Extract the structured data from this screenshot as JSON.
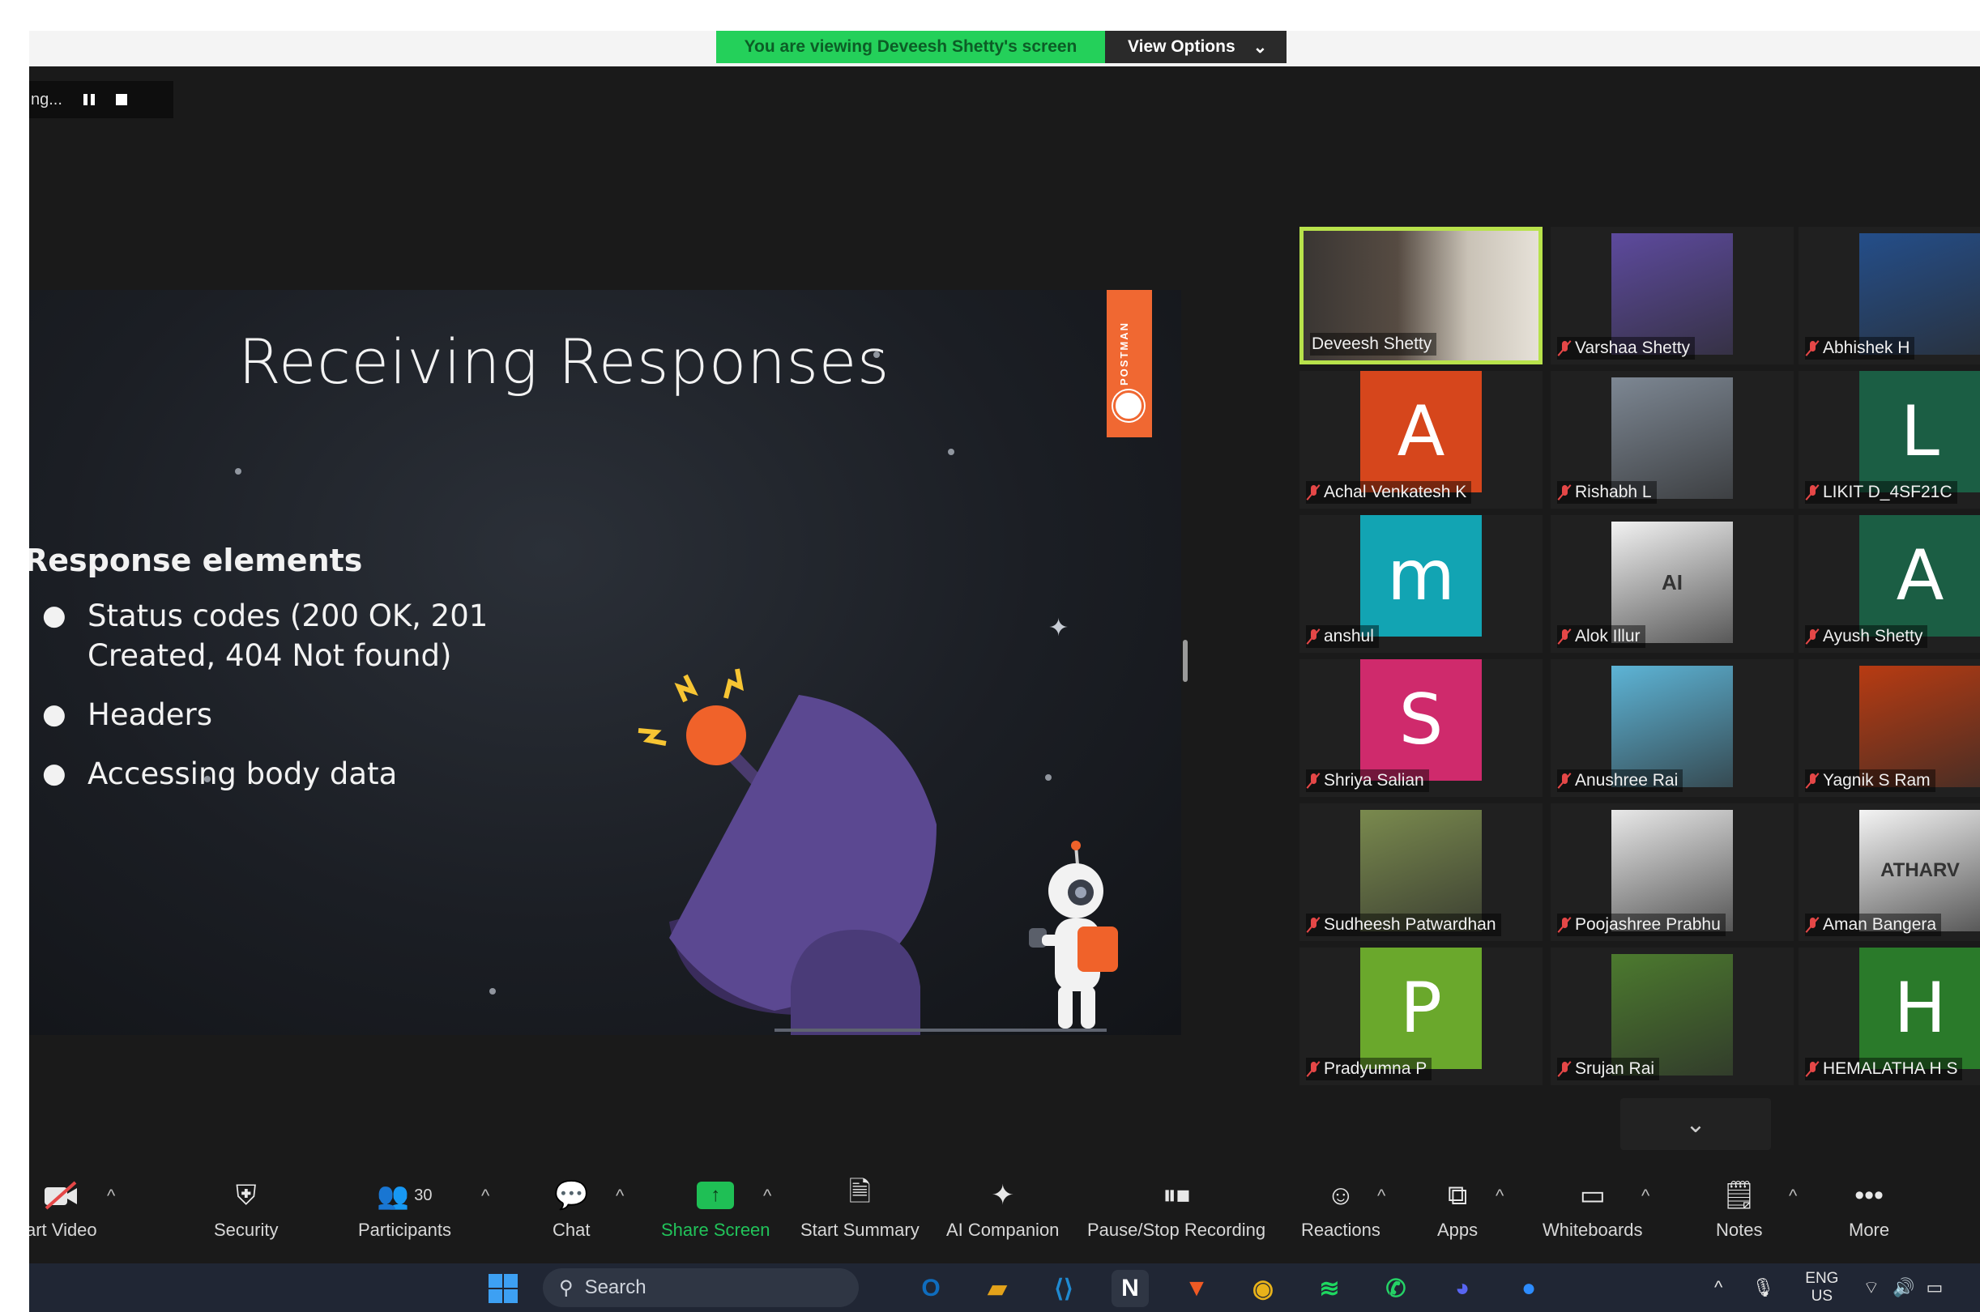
{
  "banner": {
    "viewing_text": "You are viewing Deveesh Shetty's screen",
    "view_options_label": "View Options"
  },
  "recording": {
    "status_text": "ng..."
  },
  "slide": {
    "title": "Receiving Responses",
    "brand_text": "POSTMAN",
    "heading": "Response elements",
    "bullets": [
      "Status codes (200 OK, 201\nCreated,  404 Not found)",
      "Headers",
      "Accessing body data"
    ]
  },
  "gallery": {
    "participants": [
      {
        "name": "Deveesh Shetty",
        "kind": "photo",
        "color": "#6b5a4e",
        "active": true
      },
      {
        "name": "Varshaa Shetty",
        "kind": "photo",
        "color": "#5d4a9e"
      },
      {
        "name": "Abhishek H",
        "kind": "photo",
        "color": "#244e8a"
      },
      {
        "name": "Achal Venkatesh K",
        "kind": "letter",
        "letter": "A",
        "color": "#d6461c"
      },
      {
        "name": "Rishabh L",
        "kind": "photo",
        "color": "#7d8793"
      },
      {
        "name": "LIKIT D_4SF21C",
        "kind": "letter",
        "letter": "L",
        "color": "#1b5e44"
      },
      {
        "name": "anshul",
        "kind": "letter",
        "letter": "m",
        "color": "#12a4b3"
      },
      {
        "name": "Alok Illur",
        "kind": "photo",
        "color": "#f2f2f2",
        "icon_text": "AI"
      },
      {
        "name": "Ayush Shetty",
        "kind": "letter",
        "letter": "A",
        "color": "#1b5e44"
      },
      {
        "name": "Shriya Salian",
        "kind": "letter",
        "letter": "S",
        "color": "#cf2a6c"
      },
      {
        "name": "Anushree Rai",
        "kind": "photo",
        "color": "#5db4d6"
      },
      {
        "name": "Yagnik S Ram",
        "kind": "photo",
        "color": "#b83b12"
      },
      {
        "name": "Sudheesh Patwardhan",
        "kind": "photo",
        "color": "#7a8a4e"
      },
      {
        "name": "Poojashree Prabhu",
        "kind": "photo",
        "color": "#e8e8e8"
      },
      {
        "name": "Aman Bangera",
        "kind": "photo",
        "color": "#f4f4f4",
        "icon_text": "ATHARV"
      },
      {
        "name": "Pradyumna P",
        "kind": "letter",
        "letter": "P",
        "color": "#6aa82c"
      },
      {
        "name": "Srujan Rai",
        "kind": "photo",
        "color": "#4c7a2e"
      },
      {
        "name": "HEMALATHA H S",
        "kind": "letter",
        "letter": "H",
        "color": "#2a7a2a"
      }
    ]
  },
  "toolbar": {
    "start_video": "art Video",
    "security": "Security",
    "participants": "Participants",
    "participants_count": "30",
    "chat": "Chat",
    "share_screen": "Share Screen",
    "start_summary": "Start Summary",
    "ai_companion": "AI Companion",
    "recording": "Pause/Stop Recording",
    "reactions": "Reactions",
    "apps": "Apps",
    "whiteboards": "Whiteboards",
    "notes": "Notes",
    "more": "More"
  },
  "taskbar": {
    "search_placeholder": "Search",
    "lang_top": "ENG",
    "lang_bottom": "US",
    "apps": [
      {
        "name": "outlook",
        "glyph": "O",
        "color": "#0f6cbd"
      },
      {
        "name": "file-explorer",
        "glyph": "▰",
        "color": "#e3a21a"
      },
      {
        "name": "vscode",
        "glyph": "⟨⟩",
        "color": "#1f8ad2"
      },
      {
        "name": "notion",
        "glyph": "N",
        "color": "#ffffff"
      },
      {
        "name": "brave",
        "glyph": "▼",
        "color": "#f05a24"
      },
      {
        "name": "chrome",
        "glyph": "◉",
        "color": "#e8b21a"
      },
      {
        "name": "spotify",
        "glyph": "≋",
        "color": "#1ed760"
      },
      {
        "name": "whatsapp",
        "glyph": "✆",
        "color": "#25d366"
      },
      {
        "name": "discord",
        "glyph": "◕",
        "color": "#5865f2"
      },
      {
        "name": "zoom",
        "glyph": "●",
        "color": "#2d8cff"
      }
    ]
  }
}
